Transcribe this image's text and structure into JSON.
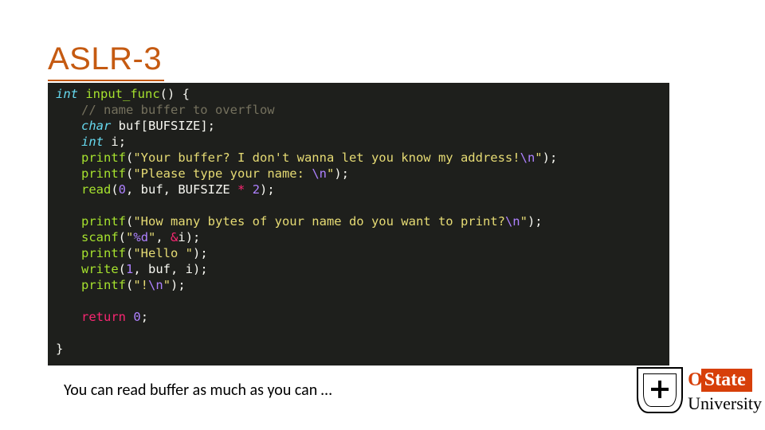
{
  "title": "ASLR-3",
  "code": {
    "lines": [
      {
        "indent": 0,
        "tokens": [
          {
            "c": "type",
            "t": "int"
          },
          {
            "c": "punct",
            "t": " "
          },
          {
            "c": "func",
            "t": "input_func"
          },
          {
            "c": "punct",
            "t": "() {"
          }
        ]
      },
      {
        "indent": 1,
        "tokens": [
          {
            "c": "comment",
            "t": "// name buffer to overflow"
          }
        ]
      },
      {
        "indent": 1,
        "tokens": [
          {
            "c": "type",
            "t": "char"
          },
          {
            "c": "punct",
            "t": " "
          },
          {
            "c": "ident",
            "t": "buf"
          },
          {
            "c": "punct",
            "t": "["
          },
          {
            "c": "ident",
            "t": "BUFSIZE"
          },
          {
            "c": "punct",
            "t": "];"
          }
        ]
      },
      {
        "indent": 1,
        "tokens": [
          {
            "c": "type",
            "t": "int"
          },
          {
            "c": "punct",
            "t": " "
          },
          {
            "c": "ident",
            "t": "i"
          },
          {
            "c": "punct",
            "t": ";"
          }
        ]
      },
      {
        "indent": 1,
        "tokens": [
          {
            "c": "func",
            "t": "printf"
          },
          {
            "c": "punct",
            "t": "("
          },
          {
            "c": "string",
            "t": "\"Your buffer? I don't wanna let you know my address!"
          },
          {
            "c": "escape",
            "t": "\\n"
          },
          {
            "c": "string",
            "t": "\""
          },
          {
            "c": "punct",
            "t": ");"
          }
        ]
      },
      {
        "indent": 1,
        "tokens": [
          {
            "c": "func",
            "t": "printf"
          },
          {
            "c": "punct",
            "t": "("
          },
          {
            "c": "string",
            "t": "\"Please type your name: "
          },
          {
            "c": "escape",
            "t": "\\n"
          },
          {
            "c": "string",
            "t": "\""
          },
          {
            "c": "punct",
            "t": ");"
          }
        ]
      },
      {
        "indent": 1,
        "tokens": [
          {
            "c": "func",
            "t": "read"
          },
          {
            "c": "punct",
            "t": "("
          },
          {
            "c": "const",
            "t": "0"
          },
          {
            "c": "punct",
            "t": ", buf, BUFSIZE "
          },
          {
            "c": "op",
            "t": "*"
          },
          {
            "c": "punct",
            "t": " "
          },
          {
            "c": "const",
            "t": "2"
          },
          {
            "c": "punct",
            "t": ");"
          }
        ]
      },
      {
        "indent": 1,
        "tokens": [
          {
            "c": "punct",
            "t": " "
          }
        ]
      },
      {
        "indent": 1,
        "tokens": [
          {
            "c": "func",
            "t": "printf"
          },
          {
            "c": "punct",
            "t": "("
          },
          {
            "c": "string",
            "t": "\"How many bytes of your name do you want to print?"
          },
          {
            "c": "escape",
            "t": "\\n"
          },
          {
            "c": "string",
            "t": "\""
          },
          {
            "c": "punct",
            "t": ");"
          }
        ]
      },
      {
        "indent": 1,
        "tokens": [
          {
            "c": "func",
            "t": "scanf"
          },
          {
            "c": "punct",
            "t": "("
          },
          {
            "c": "string",
            "t": "\""
          },
          {
            "c": "escape",
            "t": "%d"
          },
          {
            "c": "string",
            "t": "\""
          },
          {
            "c": "punct",
            "t": ", "
          },
          {
            "c": "op",
            "t": "&"
          },
          {
            "c": "punct",
            "t": "i);"
          }
        ]
      },
      {
        "indent": 1,
        "tokens": [
          {
            "c": "func",
            "t": "printf"
          },
          {
            "c": "punct",
            "t": "("
          },
          {
            "c": "string",
            "t": "\"Hello \""
          },
          {
            "c": "punct",
            "t": ");"
          }
        ]
      },
      {
        "indent": 1,
        "tokens": [
          {
            "c": "func",
            "t": "write"
          },
          {
            "c": "punct",
            "t": "("
          },
          {
            "c": "const",
            "t": "1"
          },
          {
            "c": "punct",
            "t": ", buf, i);"
          }
        ]
      },
      {
        "indent": 1,
        "tokens": [
          {
            "c": "func",
            "t": "printf"
          },
          {
            "c": "punct",
            "t": "("
          },
          {
            "c": "string",
            "t": "\"!"
          },
          {
            "c": "escape",
            "t": "\\n"
          },
          {
            "c": "string",
            "t": "\""
          },
          {
            "c": "punct",
            "t": ");"
          }
        ]
      },
      {
        "indent": 1,
        "tokens": [
          {
            "c": "punct",
            "t": " "
          }
        ]
      },
      {
        "indent": 1,
        "tokens": [
          {
            "c": "kw",
            "t": "return"
          },
          {
            "c": "punct",
            "t": " "
          },
          {
            "c": "const",
            "t": "0"
          },
          {
            "c": "punct",
            "t": ";"
          }
        ]
      },
      {
        "indent": 1,
        "tokens": [
          {
            "c": "punct",
            "t": " "
          }
        ]
      },
      {
        "indent": 0,
        "tokens": [
          {
            "c": "punct",
            "t": "}"
          }
        ]
      }
    ]
  },
  "caption": "You can read buffer as much as you can …",
  "logo": {
    "top_fragment": "O",
    "state": "State",
    "university": "University"
  }
}
